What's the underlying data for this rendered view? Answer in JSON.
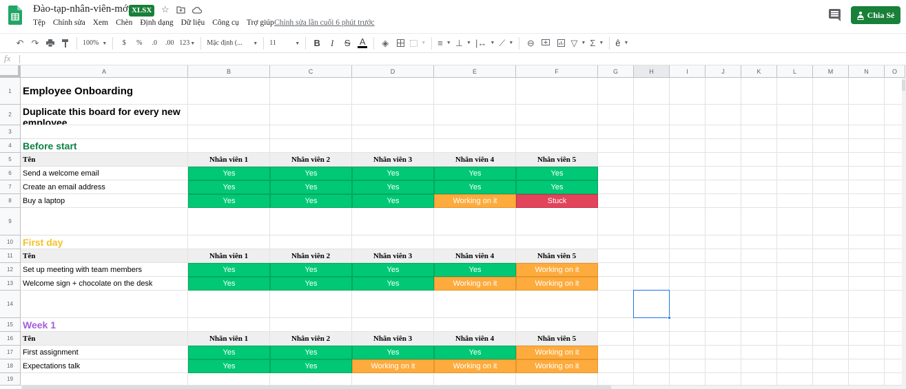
{
  "app": {
    "doc_title": "Đào-tạp-nhân-viên-mới",
    "file_badge": "XLSX",
    "last_edit": "Chỉnh sửa lần cuối 6 phút trước",
    "share_label": "Chia Sẻ",
    "menu": [
      "Tệp",
      "Chỉnh sửa",
      "Xem",
      "Chèn",
      "Định dạng",
      "Dữ liệu",
      "Công cụ",
      "Trợ giúp"
    ]
  },
  "toolbar": {
    "zoom": "100%",
    "currency": "$",
    "percent": "%",
    "dec_decrease": ".0",
    "dec_increase": ".00",
    "number_format": "123",
    "font": "Mặc định (...",
    "font_size": "11",
    "bold": "B",
    "italic": "I",
    "strike": "S",
    "text_color": "A",
    "sum": "Σ"
  },
  "formula_bar": {
    "fx": "fx",
    "value": ""
  },
  "columns": [
    "A",
    "B",
    "C",
    "D",
    "E",
    "F",
    "G",
    "H",
    "I",
    "J",
    "K",
    "L",
    "M",
    "N",
    "O"
  ],
  "selected_column": "H",
  "selected_cell": "H14",
  "rows": [
    "1",
    "2",
    "3",
    "4",
    "5",
    "6",
    "7",
    "8",
    "9",
    "10",
    "11",
    "12",
    "13",
    "14",
    "15",
    "16",
    "17",
    "18",
    "19"
  ],
  "sheet": {
    "title": "Employee Onboarding",
    "subtitle": "Duplicate this board for every new employee",
    "name_header": "Tên",
    "employee_headers": [
      "Nhân viên 1",
      "Nhân viên 2",
      "Nhân viên 3",
      "Nhân viên 4",
      "Nhân viên 5"
    ],
    "status_colors": {
      "Yes": "#00c875",
      "Working on it": "#fdab3d",
      "Stuck": "#e2445c"
    },
    "sections": [
      {
        "name": "Before start",
        "color": "#0b8043",
        "tasks": [
          {
            "task": "Send a welcome email",
            "status": [
              "Yes",
              "Yes",
              "Yes",
              "Yes",
              "Yes"
            ]
          },
          {
            "task": "Create an email address",
            "status": [
              "Yes",
              "Yes",
              "Yes",
              "Yes",
              "Yes"
            ]
          },
          {
            "task": "Buy a laptop",
            "status": [
              "Yes",
              "Yes",
              "Yes",
              "Working on it",
              "Stuck"
            ]
          }
        ]
      },
      {
        "name": "First day",
        "color": "#f6c026",
        "tasks": [
          {
            "task": "Set up meeting with team members",
            "status": [
              "Yes",
              "Yes",
              "Yes",
              "Yes",
              "Working on it"
            ]
          },
          {
            "task": "Welcome sign + chocolate on the desk",
            "status": [
              "Yes",
              "Yes",
              "Yes",
              "Working on it",
              "Working on it"
            ]
          }
        ]
      },
      {
        "name": "Week 1",
        "color": "#a25ddc",
        "tasks": [
          {
            "task": "First assignment",
            "status": [
              "Yes",
              "Yes",
              "Yes",
              "Yes",
              "Working on it"
            ]
          },
          {
            "task": "Expectations talk",
            "status": [
              "Yes",
              "Yes",
              "Working on it",
              "Working on it",
              "Working on it"
            ]
          }
        ]
      }
    ]
  }
}
